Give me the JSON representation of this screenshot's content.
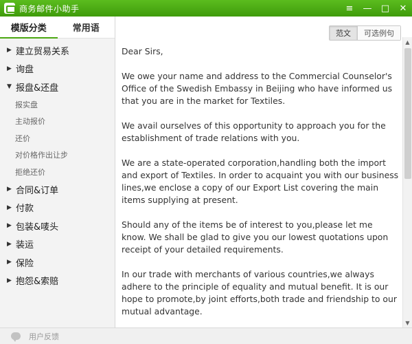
{
  "window": {
    "title": "商务邮件小助手",
    "controls": {
      "menu": "≡",
      "minimize": "—",
      "maximize": "□",
      "close": "✕"
    }
  },
  "sidebar": {
    "tabs": [
      {
        "label": "模版分类",
        "active": true
      },
      {
        "label": "常用语",
        "active": false
      }
    ],
    "categories": [
      {
        "label": "建立贸易关系",
        "expanded": false
      },
      {
        "label": "询盘",
        "expanded": false
      },
      {
        "label": "报盘&还盘",
        "expanded": true,
        "items": [
          "报实盘",
          "主动报价",
          "还价",
          "对价格作出让步",
          "拒绝还价"
        ]
      },
      {
        "label": "合同&订单",
        "expanded": false
      },
      {
        "label": "付款",
        "expanded": false
      },
      {
        "label": "包装&唛头",
        "expanded": false
      },
      {
        "label": "装运",
        "expanded": false
      },
      {
        "label": "保险",
        "expanded": false
      },
      {
        "label": "抱怨&索赔",
        "expanded": false
      }
    ],
    "arrow_collapsed": "▶",
    "arrow_expanded": "▼"
  },
  "main": {
    "view_toggle": [
      {
        "label": "范文",
        "active": true
      },
      {
        "label": "可选例句",
        "active": false
      }
    ],
    "paragraphs": [
      "Dear Sirs,",
      "We owe  your name and address to the Commercial  Counselor's Office of the Swedish Embassy in Beijing who have informed us that you are in the market for Textiles.",
      "We avail ourselves of this opportunity to approach  you for the establishment of trade relations with you.",
      "We are a state-operated corporation,handling both the import and export of Textiles. In order to acquaint you with our business lines,we enclose a copy of our Export List covering the main items supplying at present.",
      "Should any of the items be of interest to you,please let me know. We shall be glad to give you our lowest quotations upon receipt of your detailed requirements.",
      "In our trade with merchants of various countries,we always adhere to the principle of equality and mutual benefit. It is our hope to promote,by joint efforts,both trade and friendship to our mutual advantage."
    ],
    "scrollbar": {
      "up": "▲",
      "down": "▼"
    }
  },
  "footer": {
    "feedback_label": "用户反馈"
  },
  "colors": {
    "titlebar": "#4aa711",
    "accent": "#4aa711",
    "sidebar_bg": "#f3f3f3"
  }
}
